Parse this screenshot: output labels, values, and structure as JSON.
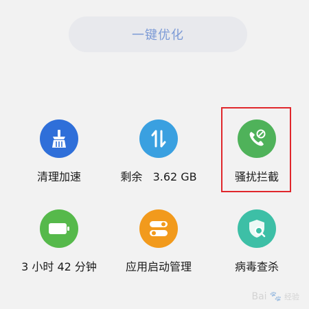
{
  "header": {
    "optimize_label": "一键优化"
  },
  "tiles": [
    {
      "label": "清理加速",
      "icon": "broom-icon",
      "color": "#2f6fd9"
    },
    {
      "label": "剩余   3.62 GB",
      "icon": "storage-arrows-icon",
      "color": "#3aa0e0"
    },
    {
      "label": "骚扰拦截",
      "icon": "call-block-icon",
      "color": "#4fb25a"
    },
    {
      "label": "3 小时 42 分钟",
      "icon": "battery-icon",
      "color": "#56b94b"
    },
    {
      "label": "应用启动管理",
      "icon": "toggle-switches-icon",
      "color": "#f29a1c"
    },
    {
      "label": "病毒查杀",
      "icon": "shield-search-icon",
      "color": "#3dbfa6"
    }
  ],
  "highlight": {
    "color": "#e0262b",
    "target": "骚扰拦截"
  },
  "watermark": {
    "brand": "Bai",
    "suffix": "经验"
  }
}
